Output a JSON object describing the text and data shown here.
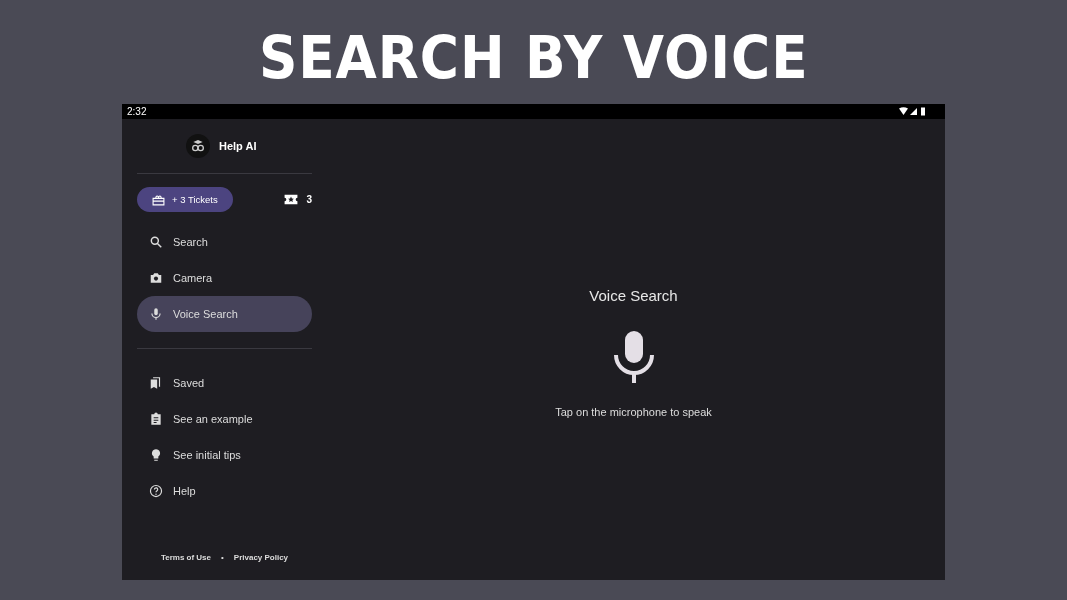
{
  "headline": "SEARCH BY VOICE",
  "status_bar": {
    "time": "2:32"
  },
  "sidebar": {
    "app_name": "Help AI",
    "tickets_button": "+ 3 Tickets",
    "ticket_count": "3",
    "nav": [
      {
        "kind": "search",
        "label": "Search",
        "selected": false
      },
      {
        "kind": "camera",
        "label": "Camera",
        "selected": false
      },
      {
        "kind": "mic",
        "label": "Voice Search",
        "selected": true
      }
    ],
    "secondary": [
      {
        "kind": "bookmark",
        "label": "Saved",
        "selected": false
      },
      {
        "kind": "clipboard",
        "label": "See an example",
        "selected": false
      },
      {
        "kind": "bulb",
        "label": "See initial tips",
        "selected": false
      },
      {
        "kind": "help",
        "label": "Help",
        "selected": false
      }
    ],
    "footer": {
      "terms": "Terms of Use",
      "separator": "•",
      "privacy": "Privacy Policy"
    }
  },
  "main": {
    "title": "Voice Search",
    "hint": "Tap on the microphone to speak"
  }
}
